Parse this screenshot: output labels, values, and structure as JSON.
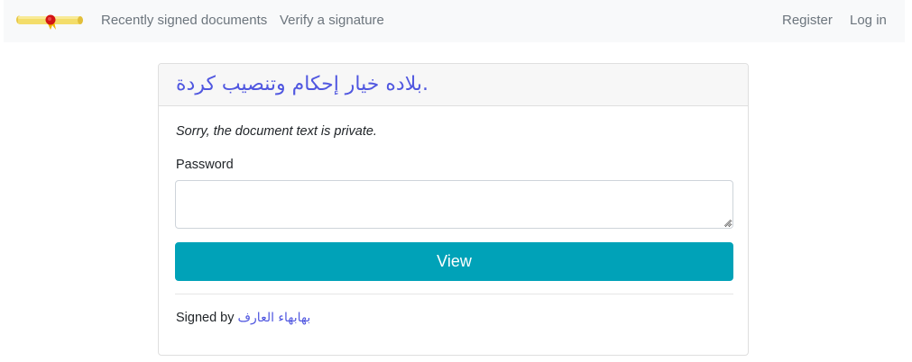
{
  "navbar": {
    "brand_icon": "scroll-seal-icon",
    "links": [
      {
        "label": "Recently signed documents"
      },
      {
        "label": "Verify a signature"
      }
    ],
    "register_label": "Register",
    "login_label": "Log in"
  },
  "card": {
    "title": "بلاده خيار إحكام وتنصيب كردة.",
    "private_note": "Sorry, the document text is private.",
    "password_label": "Password",
    "password_value": "",
    "view_label": "View",
    "signed_by_prefix": "Signed by",
    "signer_name": "بهابهاء العارف"
  },
  "colors": {
    "accent_link": "#5057e0",
    "button": "#00a2b8",
    "navbar_bg": "#f8f9fa",
    "nav_text": "#6c757d"
  }
}
